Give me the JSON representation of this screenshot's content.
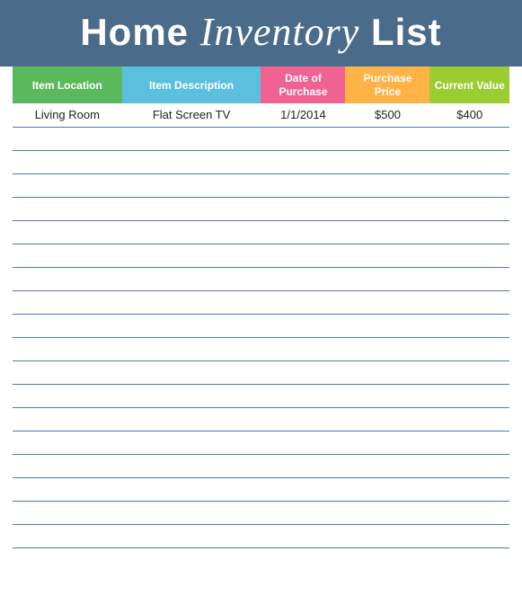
{
  "header": {
    "title_part1": "Home ",
    "title_script": "Inventory",
    "title_part2": " List"
  },
  "columns": [
    {
      "label": "Item Location",
      "class": "col-location"
    },
    {
      "label": "Item Description",
      "class": "col-description"
    },
    {
      "label": "Date of Purchase",
      "class": "col-date"
    },
    {
      "label": "Purchase Price",
      "class": "col-purchase"
    },
    {
      "label": "Current Value",
      "class": "col-value"
    }
  ],
  "rows": [
    {
      "location": "Living Room",
      "description": "Flat Screen TV",
      "date": "1/1/2014",
      "purchase": "$500",
      "value": "$400"
    },
    {
      "location": "",
      "description": "",
      "date": "",
      "purchase": "",
      "value": ""
    },
    {
      "location": "",
      "description": "",
      "date": "",
      "purchase": "",
      "value": ""
    },
    {
      "location": "",
      "description": "",
      "date": "",
      "purchase": "",
      "value": ""
    },
    {
      "location": "",
      "description": "",
      "date": "",
      "purchase": "",
      "value": ""
    },
    {
      "location": "",
      "description": "",
      "date": "",
      "purchase": "",
      "value": ""
    },
    {
      "location": "",
      "description": "",
      "date": "",
      "purchase": "",
      "value": ""
    },
    {
      "location": "",
      "description": "",
      "date": "",
      "purchase": "",
      "value": ""
    },
    {
      "location": "",
      "description": "",
      "date": "",
      "purchase": "",
      "value": ""
    },
    {
      "location": "",
      "description": "",
      "date": "",
      "purchase": "",
      "value": ""
    },
    {
      "location": "",
      "description": "",
      "date": "",
      "purchase": "",
      "value": ""
    },
    {
      "location": "",
      "description": "",
      "date": "",
      "purchase": "",
      "value": ""
    },
    {
      "location": "",
      "description": "",
      "date": "",
      "purchase": "",
      "value": ""
    },
    {
      "location": "",
      "description": "",
      "date": "",
      "purchase": "",
      "value": ""
    },
    {
      "location": "",
      "description": "",
      "date": "",
      "purchase": "",
      "value": ""
    },
    {
      "location": "",
      "description": "",
      "date": "",
      "purchase": "",
      "value": ""
    },
    {
      "location": "",
      "description": "",
      "date": "",
      "purchase": "",
      "value": ""
    },
    {
      "location": "",
      "description": "",
      "date": "",
      "purchase": "",
      "value": ""
    },
    {
      "location": "",
      "description": "",
      "date": "",
      "purchase": "",
      "value": ""
    }
  ]
}
